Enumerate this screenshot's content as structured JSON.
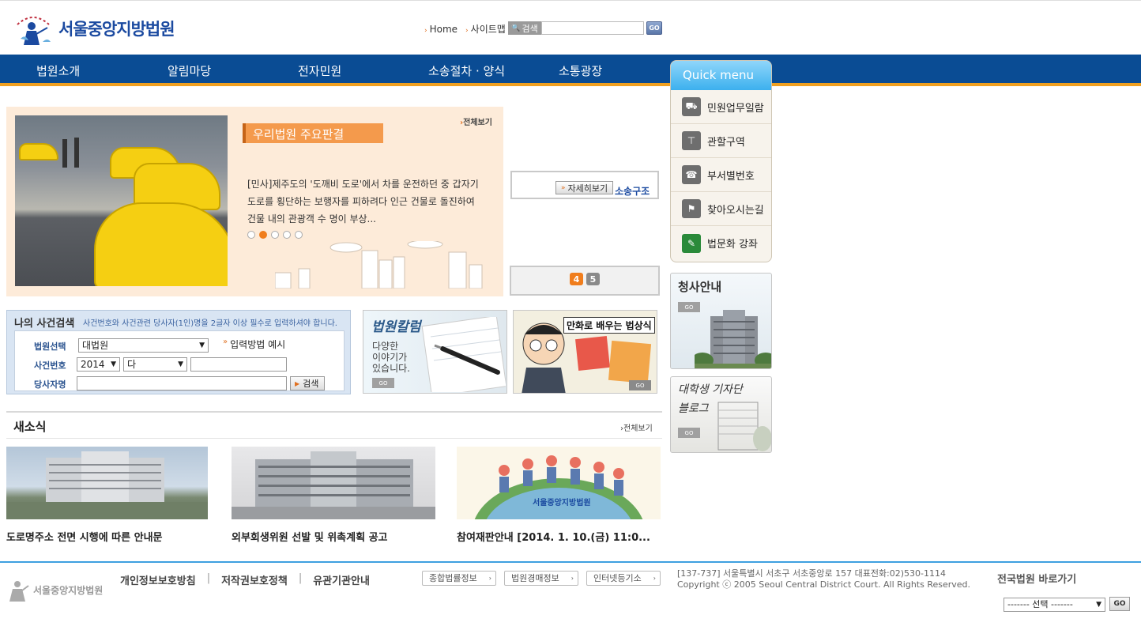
{
  "header": {
    "logo_text": "서울중앙지방법원",
    "util_links": [
      "Home",
      "사이트맵"
    ],
    "search_label": "검색",
    "search_placeholder": "",
    "go_label": "GO"
  },
  "nav": {
    "items": [
      "법원소개",
      "알림마당",
      "전자민원",
      "소송절차 · 양식",
      "소통광장"
    ]
  },
  "quick_menu": {
    "title": "Quick menu",
    "items": [
      {
        "label": "민원업무일람",
        "icon": "car-icon"
      },
      {
        "label": "관할구역",
        "icon": "signpost-icon"
      },
      {
        "label": "부서별번호",
        "icon": "phone-icon"
      },
      {
        "label": "찾아오시는길",
        "icon": "flag-icon"
      },
      {
        "label": "법문화 강좌",
        "icon": "board-icon"
      }
    ]
  },
  "side_banners": {
    "building_title": "청사안내",
    "building_go": "GO",
    "blog_title_line1": "대학생 기자단",
    "blog_title_line2": "블로그",
    "blog_go": "GO"
  },
  "feature": {
    "tag": "우리법원 주요판결",
    "more": "전체보기",
    "text": "[민사]제주도의 '도깨비 도로'에서 차를 운전하던 중 갑자기 도로를 횡단하는 보행자를 피하려다 인근 건물로 돌진하여 건물 내의 관광객 수 명이 부상...",
    "dots_total": 5,
    "dots_active": 2
  },
  "middle": {
    "detail_button": "자세히보기",
    "detail_text": "소송구조",
    "pages": [
      "4",
      "5"
    ]
  },
  "case_search": {
    "title": "나의 사건검색",
    "subtitle": "사건번호와 사건관련 당사자(1인)명을 2글자 이상 필수로 입력하셔야 합니다.",
    "court_label": "법원선택",
    "court_value": "대법원",
    "example_link": "입력방법 예시",
    "number_label": "사건번호",
    "year_value": "2014",
    "type_value": "다",
    "party_label": "당사자명",
    "search_button": "검색"
  },
  "banners": {
    "column_title": "법원칼럼",
    "column_text_1": "다양한",
    "column_text_2": "이야기가",
    "column_text_3": "있습니다.",
    "column_go": "GO",
    "comic_title": "만화로 배우는 법상식",
    "comic_go": "GO"
  },
  "news": {
    "title": "새소식",
    "more": "전체보기",
    "items": [
      "도로명주소 전면 시행에 따른 안내문",
      "외부회생위원 선발 및 위촉계획 공고",
      "참여재판안내 [2014. 1. 10.(금) 11:0..."
    ],
    "globe_caption": "서울중앙지방법원"
  },
  "footer": {
    "logo_text": "서울중앙지방법원",
    "links": [
      "개인정보보호방침",
      "저작권보호정책",
      "유관기관안내"
    ],
    "separator": "|",
    "selects": [
      "종합법률정보",
      "법원경매정보",
      "인터넷등기소"
    ],
    "address": "[137-737] 서울특별시 서초구 서초중앙로 157 대표전화:02)530-1114",
    "copyright": "Copyright ⓒ 2005 Seoul Central District Court. All Rights Reserved.",
    "national_title": "전국법원 바로가기",
    "national_select": "------- 선택 -------",
    "go_label": "GO"
  },
  "colors": {
    "nav_bg": "#0a4c94",
    "nav_accent": "#f0a020",
    "quick_head": "#3cb0ee",
    "feature_bg": "#fdebd9",
    "feature_tag": "#f49a4c",
    "active_dot": "#f07d1c",
    "footer_line": "#3ea0e0"
  }
}
